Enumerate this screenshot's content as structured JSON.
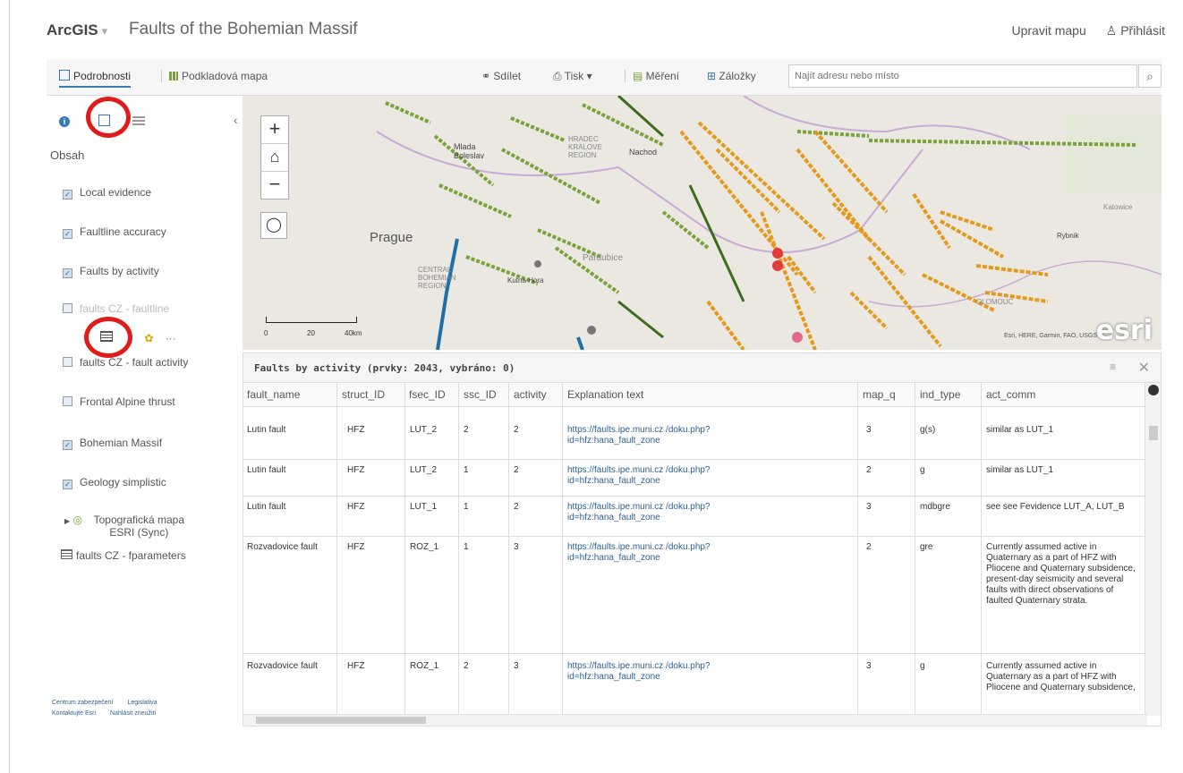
{
  "header": {
    "brand": "ArcGIS",
    "title": "Faults of the Bohemian Massif",
    "edit_map": "Upravit mapu",
    "sign_in": "Přihlásit"
  },
  "toolbar": {
    "details": "Podrobnosti",
    "basemap": "Podkladová mapa",
    "share": "Sdílet",
    "print": "Tisk",
    "measure": "Měření",
    "bookmarks": "Záložky",
    "search_placeholder": "Najít adresu nebo místo"
  },
  "sidebar": {
    "contents_label": "Obsah",
    "layers": [
      {
        "label": "Local evidence",
        "checked": true
      },
      {
        "label": "Faultline accuracy",
        "checked": true
      },
      {
        "label": "Faults by activity",
        "checked": true
      },
      {
        "label": "faults CZ - faultline",
        "checked": false
      },
      {
        "label": "faults CZ - fault activity",
        "checked": false
      },
      {
        "label": "Frontal Alpine thrust",
        "checked": false
      },
      {
        "label": "Bohemian Massif",
        "checked": true
      },
      {
        "label": "Geology simplistic",
        "checked": true
      },
      {
        "label": "Topografická mapa ESRI (Sync)",
        "checked": false
      },
      {
        "label": "faults CZ - fparameters",
        "checked": false
      }
    ],
    "footer": {
      "privacy": "Centrum zabezpečení",
      "legal": "Legislativa",
      "contact": "Kontaktujte Esri",
      "abuse": "Nahlásit zneužití"
    }
  },
  "map": {
    "labels": {
      "prague": "Prague",
      "pardubice": "Pardubice",
      "hradec": "HRADEC KRALOVE REGION",
      "central": "CENTRAL BOHEMIAN REGION",
      "kutna": "Kutna Hora",
      "nachod": "Nachod",
      "mlada": "Mlada Boleslav",
      "katowice": "Katowice",
      "rybnik": "Rybnik",
      "olomouc": "OLOMOUC"
    },
    "scale_labels": [
      "0",
      "20",
      "40km"
    ],
    "attribution": "Esri, HERE, Garmin, FAO, USGS",
    "esri_logo": "esri"
  },
  "attribute_table": {
    "title": "Faults by activity (prvky: 2043, vybráno: 0)",
    "columns": [
      "fault_name",
      "struct_ID",
      "fsec_ID",
      "ssc_ID",
      "activity",
      "Explanation text",
      "map_q",
      "ind_type",
      "act_comm"
    ],
    "rows": [
      {
        "fault_name": "Lutin fault",
        "struct_ID": "HFZ",
        "fsec_ID": "LUT_2",
        "ssc_ID": "2",
        "activity": "2",
        "explanation": "https://faults.ipe.muni.cz /doku.php?id=hfz:hana_fault_zone",
        "map_q": "3",
        "ind_type": "g(s)",
        "act_comm": "similar as LUT_1"
      },
      {
        "fault_name": "Lutin fault",
        "struct_ID": "HFZ",
        "fsec_ID": "LUT_2",
        "ssc_ID": "1",
        "activity": "2",
        "explanation": "https://faults.ipe.muni.cz /doku.php?id=hfz:hana_fault_zone",
        "map_q": "2",
        "ind_type": "g",
        "act_comm": "similar as LUT_1"
      },
      {
        "fault_name": "Lutin fault",
        "struct_ID": "HFZ",
        "fsec_ID": "LUT_1",
        "ssc_ID": "1",
        "activity": "2",
        "explanation": "https://faults.ipe.muni.cz /doku.php?id=hfz:hana_fault_zone",
        "map_q": "3",
        "ind_type": "mdbgre",
        "act_comm": "see see Fevidence LUT_A, LUT_B"
      },
      {
        "fault_name": "Rozvadovice fault",
        "struct_ID": "HFZ",
        "fsec_ID": "ROZ_1",
        "ssc_ID": "1",
        "activity": "3",
        "explanation": "https://faults.ipe.muni.cz /doku.php?id=hfz:hana_fault_zone",
        "map_q": "2",
        "ind_type": "gre",
        "act_comm": "Currently assumed active in Quaternary as a part of HFZ with Pliocene and Quaternary subsidence, present-day seismicity and several faults with direct observations of faulted Quaternary strata."
      },
      {
        "fault_name": "Rozvadovice fault",
        "struct_ID": "HFZ",
        "fsec_ID": "ROZ_1",
        "ssc_ID": "2",
        "activity": "3",
        "explanation": "https://faults.ipe.muni.cz /doku.php?id=hfz:hana_fault_zone",
        "map_q": "3",
        "ind_type": "g",
        "act_comm": "Currently assumed active in Quaternary as a part of HFZ with Pliocene and Quaternary subsidence,"
      }
    ]
  },
  "colors": {
    "accent": "#3a78b5",
    "highlight_ring": "#e01b1b",
    "fault_green": "#7aa23a",
    "fault_orange": "#e39a1c",
    "fault_blue": "#1f6fa8",
    "fault_darkgreen": "#3e6b1e"
  }
}
